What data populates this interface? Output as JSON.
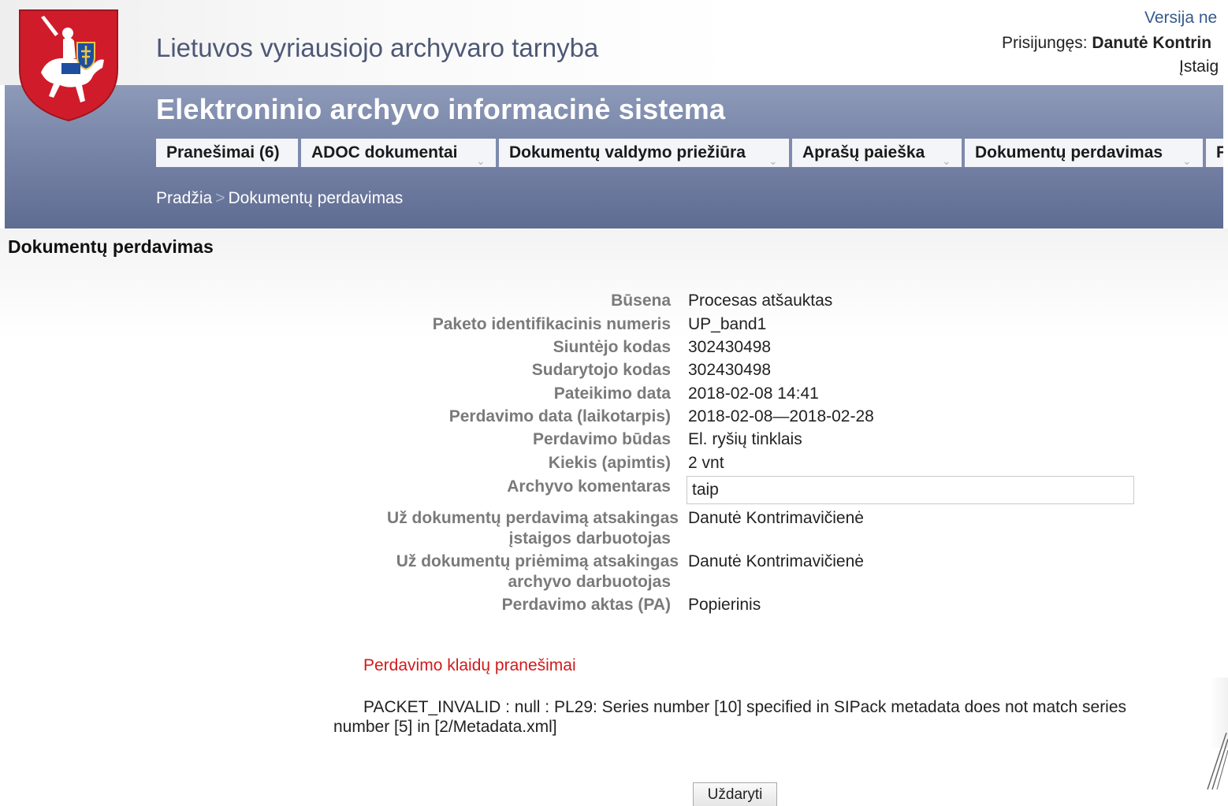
{
  "header": {
    "agency_name": "Lietuvos vyriausiojo archyvaro tarnyba",
    "system_title": "Elektroninio archyvo informacinė sistema",
    "version_link": "Versija ne",
    "login_label": "Prisijungęs:",
    "login_user": "Danutė Kontrin",
    "institution": "Įstaig"
  },
  "nav": {
    "items": [
      {
        "label": "Pranešimai (6)"
      },
      {
        "label": "ADOC dokumentai"
      },
      {
        "label": "Dokumentų valdymo priežiūra"
      },
      {
        "label": "Aprašų paieška"
      },
      {
        "label": "Dokumentų perdavimas"
      },
      {
        "label": "F"
      }
    ]
  },
  "breadcrumb": {
    "home": "Pradžia",
    "separator": ">",
    "current": "Dokumentų perdavimas"
  },
  "page": {
    "title": "Dokumentų perdavimas"
  },
  "details": {
    "status_label": "Būsena",
    "status_value": "Procesas atšauktas",
    "package_id_label": "Paketo identifikacinis numeris",
    "package_id_value": "UP_band1",
    "sender_code_label": "Siuntėjo kodas",
    "sender_code_value": "302430498",
    "creator_code_label": "Sudarytojo kodas",
    "creator_code_value": "302430498",
    "submission_date_label": "Pateikimo data",
    "submission_date_value": "2018-02-08 14:41",
    "transfer_period_label": "Perdavimo data (laikotarpis)",
    "transfer_period_value": "2018-02-08—2018-02-28",
    "transfer_method_label": "Perdavimo būdas",
    "transfer_method_value": "El. ryšių tinklais",
    "quantity_label": "Kiekis (apimtis)",
    "quantity_value": "2 vnt",
    "archive_comment_label": "Archyvo komentaras",
    "archive_comment_value": "taip",
    "transfer_responsible_label_line1": "Už dokumentų perdavimą atsakingas",
    "transfer_responsible_label_line2": "įstaigos darbuotojas",
    "transfer_responsible_value": "Danutė Kontrimavičienė",
    "receipt_responsible_label_line1": "Už dokumentų priėmimą atsakingas",
    "receipt_responsible_label_line2": "archyvo darbuotojas",
    "receipt_responsible_value": "Danutė Kontrimavičienė",
    "transfer_act_label": "Perdavimo aktas (PA)",
    "transfer_act_value": "Popierinis"
  },
  "errors": {
    "heading": "Perdavimo klaidų pranešimai",
    "message": "PACKET_INVALID : null : PL29: Series number [10] specified in SIPack metadata does not match series number [5] in [2/Metadata.xml]"
  },
  "actions": {
    "close_label": "Uždaryti"
  },
  "colors": {
    "band": "#7e8bad",
    "error": "#d11a1a",
    "label": "#7a7a7a",
    "link": "#355a8e"
  },
  "icons": {
    "coat_of_arms": "vytis-coat-of-arms-icon",
    "nav_dropdown": "chevron-down-icon"
  }
}
